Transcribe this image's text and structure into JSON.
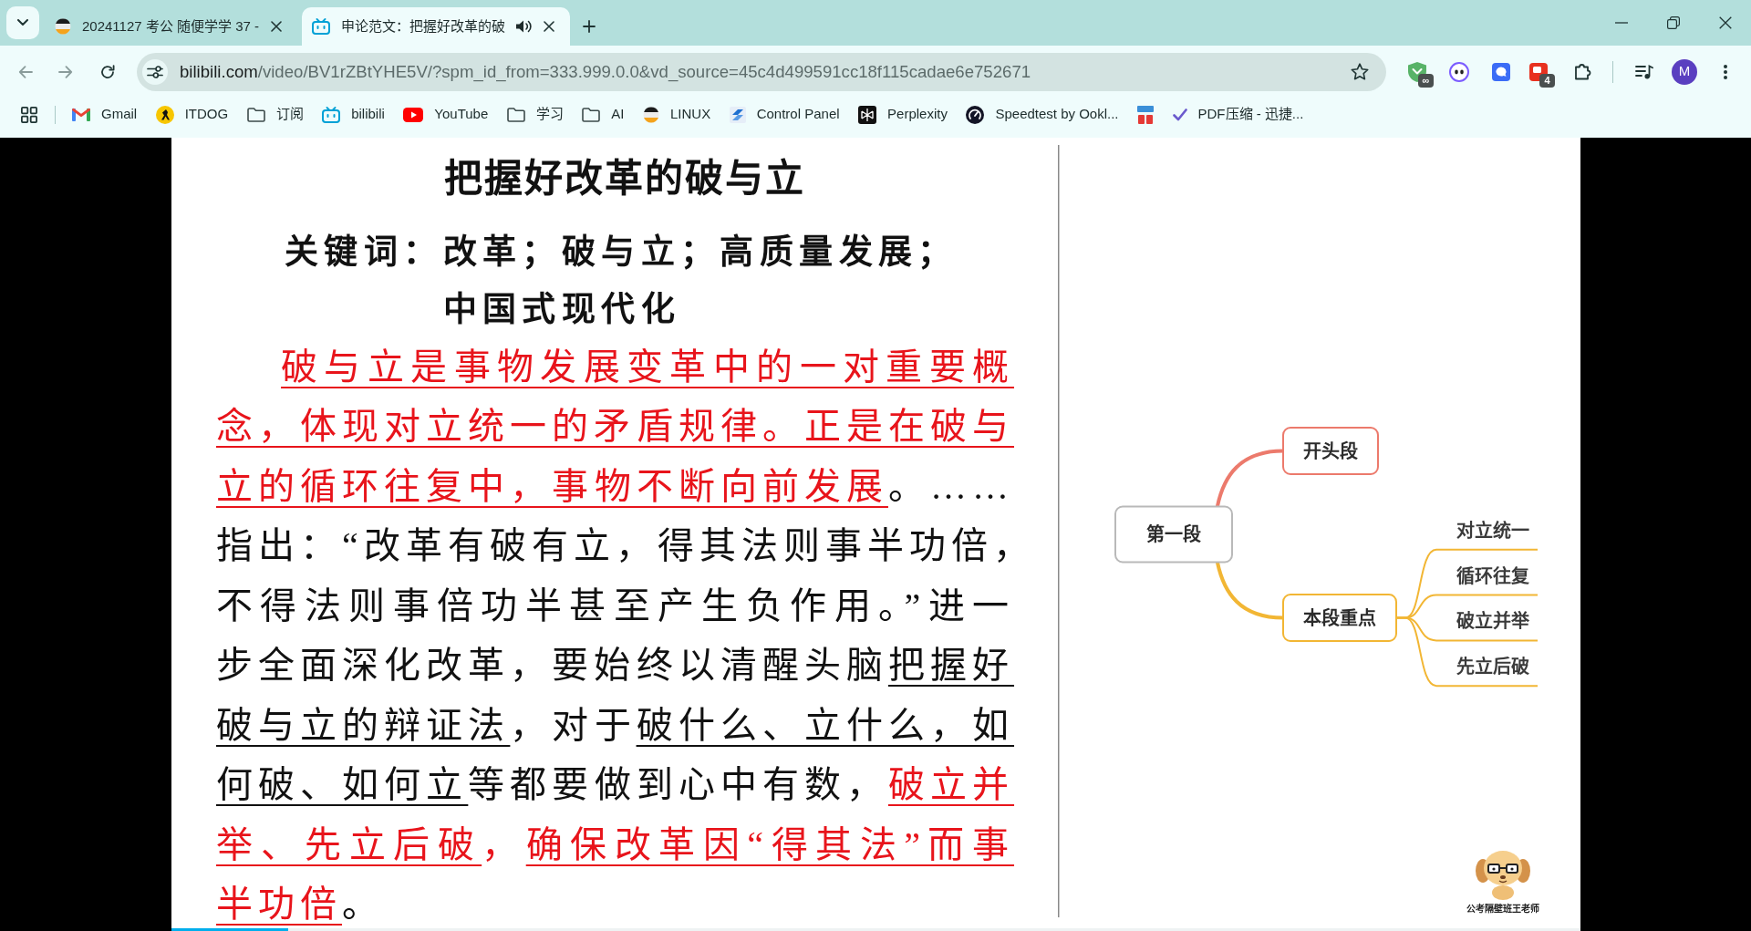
{
  "tabs": [
    {
      "title": "20241127 考公 随便学学 37 -",
      "kind": "linux",
      "selected": false,
      "audio": false
    },
    {
      "title": "申论范文：把握好改革的破",
      "kind": "bilibili",
      "selected": true,
      "audio": true
    }
  ],
  "navigation": {
    "back": {
      "disabled": true
    },
    "forward": {
      "disabled": true
    }
  },
  "address_bar": {
    "host": "bilibili.com",
    "path": "/video/BV1rZBtYHE5V/?spm_id_from=333.999.0.0&vd_source=45c4d499591cc18f115cadae6e752671"
  },
  "extensions": [
    {
      "kind": "shield",
      "badge": "∞"
    },
    {
      "kind": "eyes"
    },
    {
      "kind": "chat"
    },
    {
      "kind": "note",
      "badge": "4"
    }
  ],
  "profile": {
    "initial": "M"
  },
  "bookmarks": [
    {
      "kind": "gmail",
      "label": "Gmail"
    },
    {
      "kind": "itdog",
      "label": "ITDOG"
    },
    {
      "kind": "folder",
      "label": "订阅"
    },
    {
      "kind": "bilibili",
      "label": "bilibili"
    },
    {
      "kind": "youtube",
      "label": "YouTube"
    },
    {
      "kind": "folder",
      "label": "学习"
    },
    {
      "kind": "folder",
      "label": "AI"
    },
    {
      "kind": "linux",
      "label": "LINUX"
    },
    {
      "kind": "control_panel",
      "label": "Control Panel"
    },
    {
      "kind": "perplexity",
      "label": "Perplexity"
    },
    {
      "kind": "speedtest",
      "label": "Speedtest by Ookl..."
    },
    {
      "kind": "pdf24"
    },
    {
      "kind": "check",
      "label": "PDF压缩 - 迅捷..."
    }
  ],
  "video": {
    "slide": {
      "title": "把握好改革的破与立",
      "keywords": {
        "label": "关键词：",
        "lines": [
          "改革；破与立；高质量发展；",
          "中国式现代化"
        ]
      },
      "body_lines": [
        [
          {
            "text": "破与立是事物发展变革中的一对重要概",
            "kind": "highlight"
          }
        ],
        [
          {
            "text": "念，体现对立统一的矛盾规律。正是在破与",
            "kind": "highlight"
          }
        ],
        [
          {
            "text": "立的循环往复中，事物不断向前发展",
            "kind": "highlight"
          },
          {
            "text": "。……",
            "kind": "plain"
          }
        ],
        [
          {
            "text": "指出：“改革有破有立，得其法则事半功倍，",
            "kind": "plain"
          }
        ],
        [
          {
            "text": "不得法则事倍功半甚至产生负作用。”进一",
            "kind": "plain"
          }
        ],
        [
          {
            "text": "步全面深化改革，要始终以清醒头脑",
            "kind": "plain"
          },
          {
            "text": "把握好",
            "kind": "underline"
          }
        ],
        [
          {
            "text": "破与立的辩证法",
            "kind": "underline"
          },
          {
            "text": "，对于",
            "kind": "plain"
          },
          {
            "text": "破什么、立什么，如",
            "kind": "underline"
          }
        ],
        [
          {
            "text": "何破、如何立",
            "kind": "underline"
          },
          {
            "text": "等都要做到心中有数，",
            "kind": "plain"
          },
          {
            "text": "破立并",
            "kind": "highlight"
          }
        ],
        [
          {
            "text": "举、先立后破",
            "kind": "highlight"
          },
          {
            "text": "，",
            "kind": "highlight_mark"
          },
          {
            "text": "确保改革因“得其法”而事",
            "kind": "highlight"
          }
        ],
        [
          {
            "text": "半功倍",
            "kind": "highlight"
          },
          {
            "text": "。",
            "kind": "plain"
          }
        ]
      ]
    },
    "mind_map": {
      "root": {
        "label": "第一段",
        "children": [
          {
            "label": "开头段",
            "color": "#ec7a6c"
          },
          {
            "label": "本段重点",
            "color": "#f2b634",
            "children": [
              {
                "label": "对立统一"
              },
              {
                "label": "循环往复"
              },
              {
                "label": "破立并举"
              },
              {
                "label": "先立后破"
              }
            ]
          }
        ]
      }
    },
    "logo_caption": "公考隔壁班王老师",
    "progress": {
      "level": 0.083
    }
  }
}
